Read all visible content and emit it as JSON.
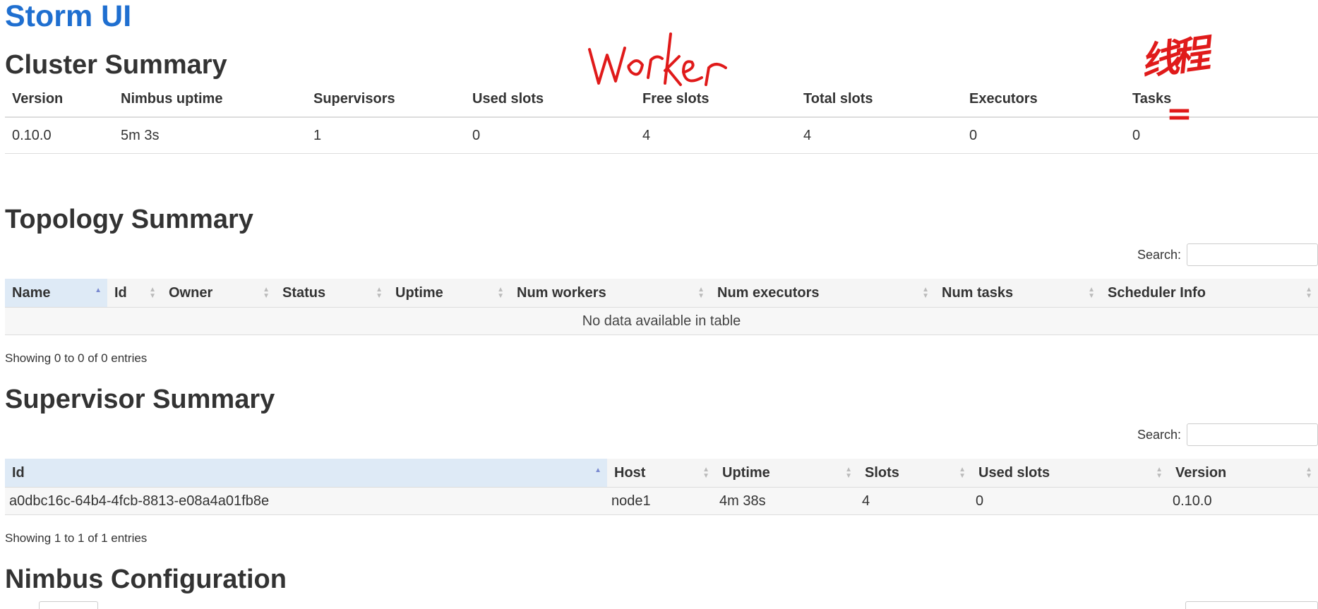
{
  "app": {
    "title": "Storm UI"
  },
  "cluster_summary": {
    "title": "Cluster Summary",
    "columns": [
      "Version",
      "Nimbus uptime",
      "Supervisors",
      "Used slots",
      "Free slots",
      "Total slots",
      "Executors",
      "Tasks"
    ],
    "row": [
      "0.10.0",
      "5m 3s",
      "1",
      "0",
      "4",
      "4",
      "0",
      "0"
    ]
  },
  "topology_summary": {
    "title": "Topology Summary",
    "search_label": "Search:",
    "search_value": "",
    "columns": [
      "Name",
      "Id",
      "Owner",
      "Status",
      "Uptime",
      "Num workers",
      "Num executors",
      "Num tasks",
      "Scheduler Info"
    ],
    "empty_message": "No data available in table",
    "info": "Showing 0 to 0 of 0 entries"
  },
  "supervisor_summary": {
    "title": "Supervisor Summary",
    "search_label": "Search:",
    "search_value": "",
    "columns": [
      "Id",
      "Host",
      "Uptime",
      "Slots",
      "Used slots",
      "Version"
    ],
    "rows": [
      [
        "a0dbc16c-64b4-4fcb-8813-e08a4a01fb8e",
        "node1",
        "4m 38s",
        "4",
        "0",
        "0.10.0"
      ]
    ],
    "info": "Showing 1 to 1 of 1 entries"
  },
  "nimbus_configuration": {
    "title": "Nimbus Configuration"
  },
  "annotations": {
    "color": "#e01a1a",
    "worker_text": "worker",
    "thread_text": "线程",
    "equals_text": "="
  },
  "colors": {
    "title_blue": "#1f6fd0",
    "sorted_header_bg": "#deeaf6",
    "header_bg": "#f5f5f5",
    "row_bg": "#f7f7f7"
  }
}
